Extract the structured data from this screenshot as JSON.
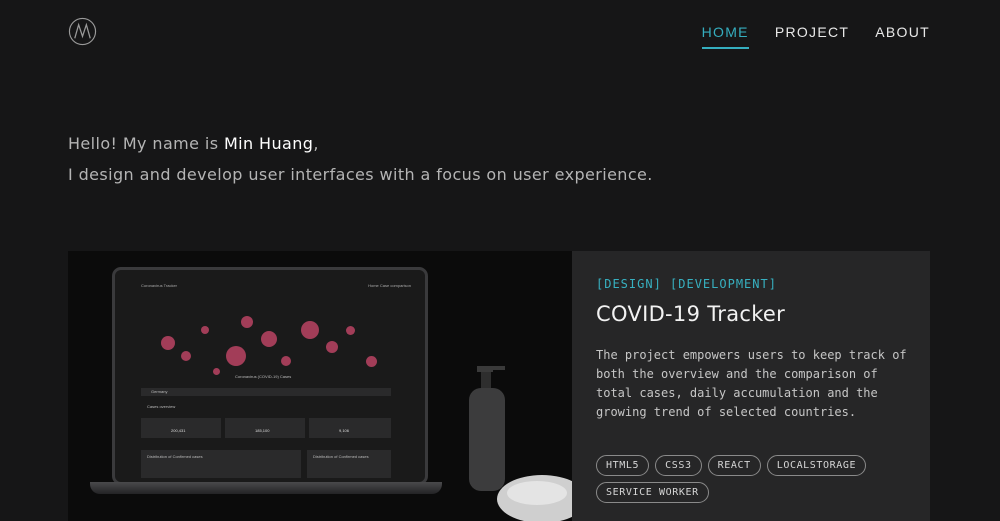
{
  "header": {
    "logo_icon": "m-monogram-icon",
    "nav": [
      {
        "label": "HOME",
        "active": true
      },
      {
        "label": "PROJECT",
        "active": false
      },
      {
        "label": "ABOUT",
        "active": false
      }
    ]
  },
  "intro": {
    "line1_prefix": "Hello! My name is ",
    "name": "Min Huang",
    "line1_suffix": ",",
    "line2": "I design and develop user interfaces with a focus on user experience."
  },
  "project": {
    "tags_label": "[DESIGN] [DEVELOPMENT]",
    "title": "COVID-19 Tracker",
    "description": "The project empowers users to keep track of both the overview and the comparison of total cases, daily accumulation and the growing trend of selected countries.",
    "chips": [
      "HTML5",
      "CSS3",
      "REACT",
      "LOCALSTORAGE",
      "SERVICE WORKER"
    ],
    "image": {
      "app_title": "Coronavirus Tracker",
      "app_nav": "Home   Case comparison",
      "map_caption": "Coronavirus (COVID-19) Cases",
      "country": "Germany",
      "overview_label": "Cases overview",
      "stats": [
        "200,431",
        "185,100",
        "9,106"
      ],
      "section_left": "Distribution of Confirmed cases",
      "section_right": "Distribution of Confirmed cases"
    }
  },
  "colors": {
    "accent": "#35aebf",
    "background": "#161617",
    "card": "#262627",
    "marker": "#d04a6e"
  }
}
